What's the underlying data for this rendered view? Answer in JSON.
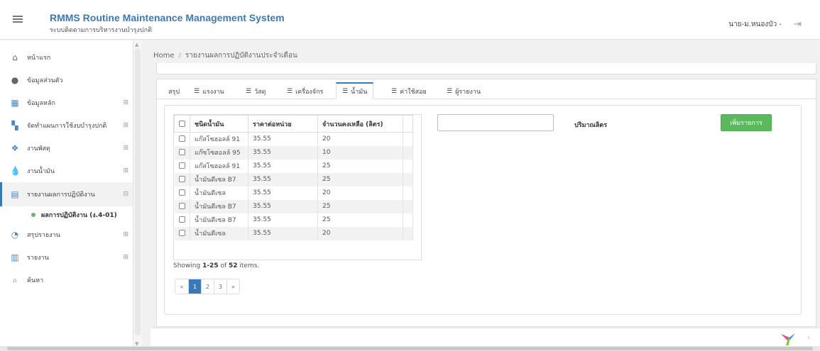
{
  "header": {
    "title": "RMMS Routine Maintenance Management System",
    "subtitle": "ระบบติดตามการบริหารงานบำรุงปกติ",
    "user": "นาย-ม.หนองบัว -",
    "menu_icon": "hamburger-icon",
    "logout_icon": "logout-icon"
  },
  "sidebar": {
    "items": [
      {
        "label": "หน้าแรก",
        "icon": "home-icon"
      },
      {
        "label": "ข้อมูลส่วนตัว",
        "icon": "user-icon"
      },
      {
        "label": "ข้อมูลหลัก",
        "icon": "table-icon"
      },
      {
        "label": "จัดทำแผนการใช้งบบำรุงปกติ",
        "icon": "grid-icon"
      },
      {
        "label": "งานพัสดุ",
        "icon": "cubes-icon"
      },
      {
        "label": "งานน้ำมัน",
        "icon": "drop-icon"
      },
      {
        "label": "รายงานผลการปฏิบัติงาน",
        "icon": "report-icon"
      },
      {
        "label": "สรุปรายงาน",
        "icon": "pie-chart-icon"
      },
      {
        "label": "รายงาน",
        "icon": "bar-chart-icon"
      },
      {
        "label": "ค้นหา",
        "icon": "search-icon"
      }
    ],
    "sub_item": "ผลการปฏิบัติงาน (ง.4-01)"
  },
  "breadcrumb": {
    "home": "Home",
    "separator": "/",
    "current": "รายงานผลการปฏิบัติงานประจำเดือน"
  },
  "tabs": [
    {
      "label": "สรุป",
      "icon": ""
    },
    {
      "label": "แรงงาน",
      "icon": "list-icon"
    },
    {
      "label": "วัสดุ",
      "icon": "list-icon"
    },
    {
      "label": "เครื่องจักร",
      "icon": "list-icon"
    },
    {
      "label": "น้ำมัน",
      "icon": "list-icon"
    },
    {
      "label": "ค่าใช้สอย",
      "icon": "list-icon"
    },
    {
      "label": "ผู้รายงาน",
      "icon": "list-icon"
    }
  ],
  "active_tab": "น้ำมัน",
  "table": {
    "headers": [
      "ชนิดน้ำมัน",
      "ราคาต่อหน่วย",
      "จำนวนคงเหลือ (ลิตร)"
    ],
    "rows": [
      [
        "แก๊สโซฮอลล์ 91",
        "35.55",
        "20"
      ],
      [
        "แก๊ซโซฮอลล์ 95",
        "35.55",
        "10"
      ],
      [
        "แก๊สโซฮอลล์ 91",
        "35.55",
        "25"
      ],
      [
        "น้ำมันดีเซล B7",
        "35.55",
        "25"
      ],
      [
        "น้ำมันดีเซล",
        "35.55",
        "20"
      ],
      [
        "น้ำมันดีเซล B7",
        "35.55",
        "25"
      ],
      [
        "น้ำมันดีเซล B7",
        "35.55",
        "25"
      ],
      [
        "น้ำมันดีเซล",
        "35.55",
        "20"
      ]
    ]
  },
  "summary": {
    "prefix": "Showing ",
    "range": "1-25",
    "middle": " of ",
    "total": "52",
    "suffix": " items."
  },
  "pagination": [
    "«",
    "1",
    "2",
    "3",
    "»"
  ],
  "active_page": "1",
  "form": {
    "quantity_label": "ปริมาณลิตร",
    "quantity_value": "",
    "add_button": "เพิ่มรายการ"
  },
  "colors": {
    "accent": "#3a79b8",
    "button_green": "#5cb85c"
  }
}
